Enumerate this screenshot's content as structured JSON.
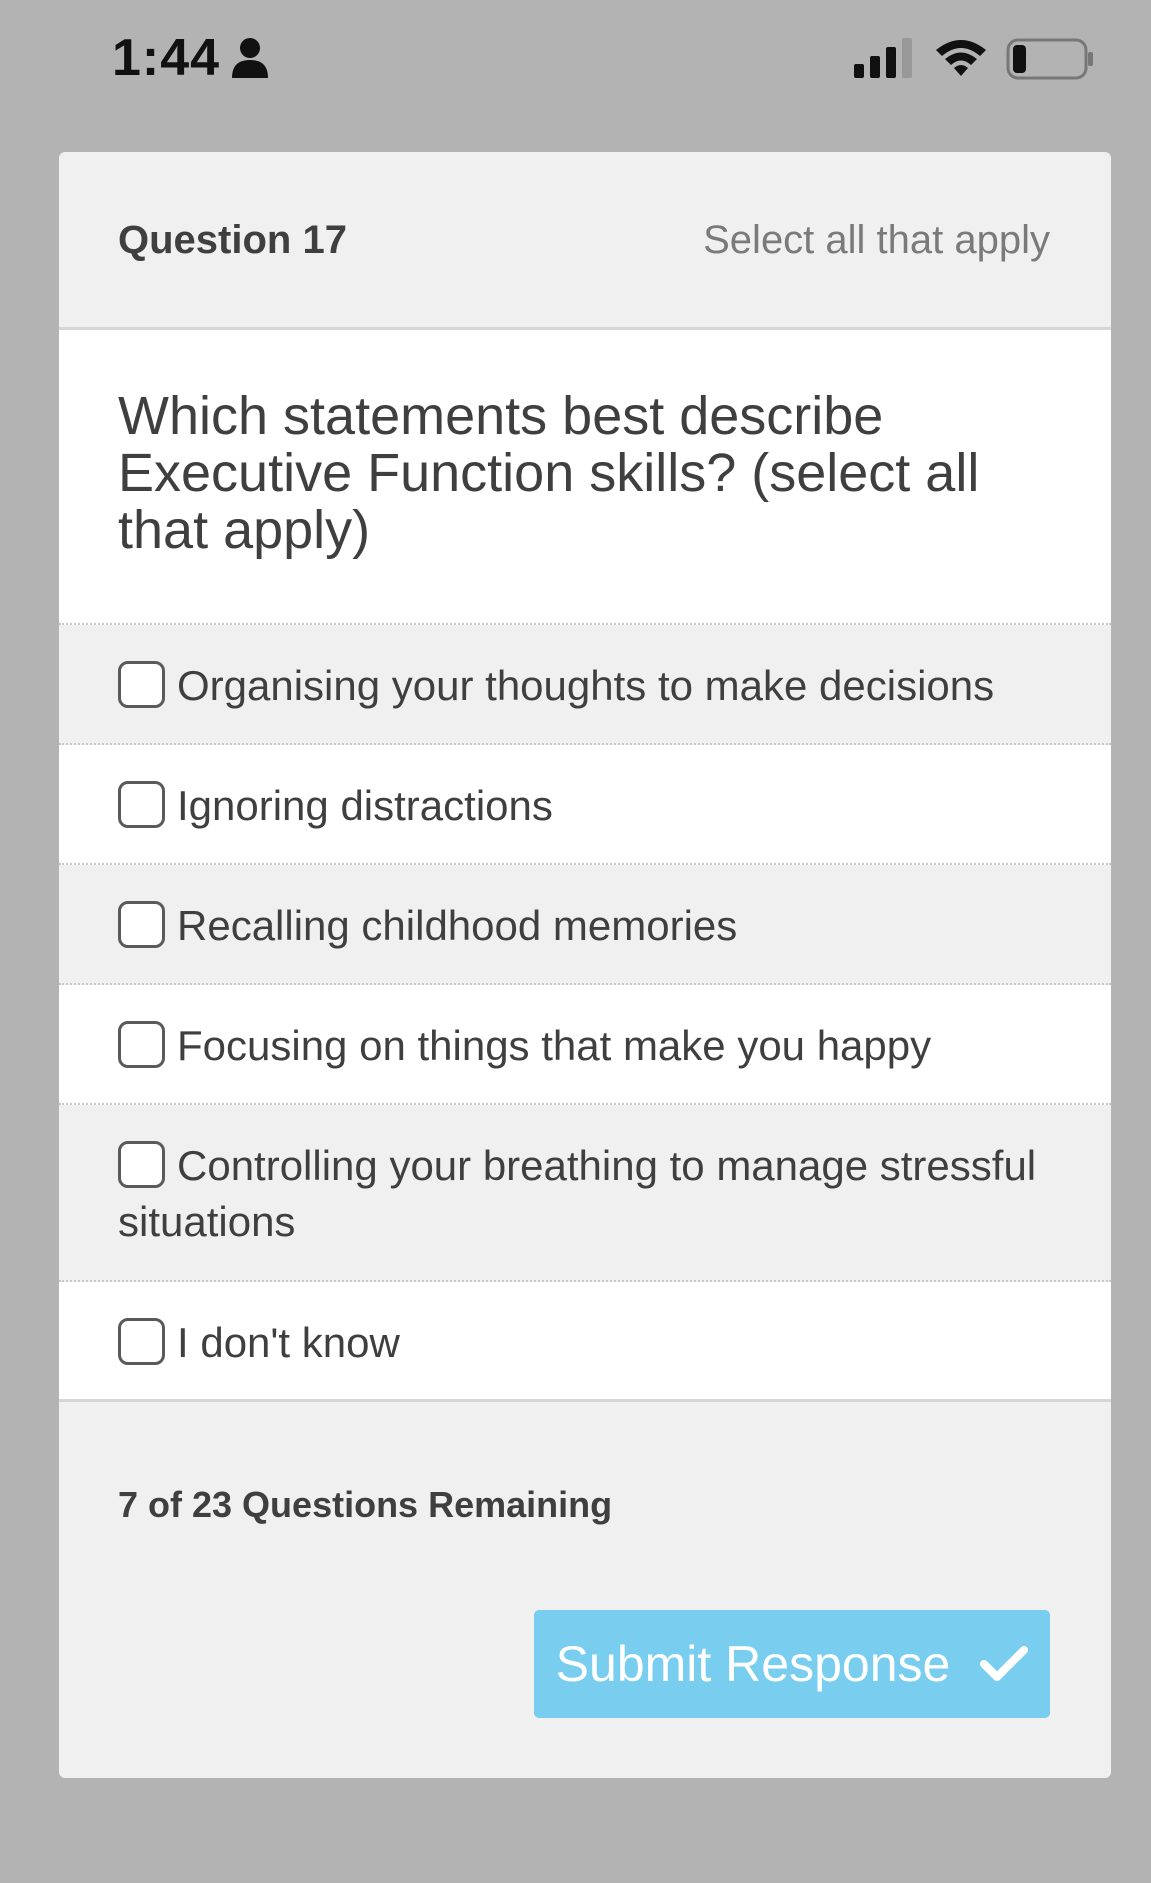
{
  "status_bar": {
    "time": "1:44",
    "icons": [
      "person-icon",
      "cellular-signal-icon",
      "wifi-icon",
      "battery-icon"
    ]
  },
  "header": {
    "question_number": "Question 17",
    "hint": "Select all that apply"
  },
  "question": {
    "text": "Which statements best describe Executive Function skills? (select all that apply)"
  },
  "options": [
    {
      "label": "Organising your thoughts to make decisions",
      "checked": false
    },
    {
      "label": "Ignoring distractions",
      "checked": false
    },
    {
      "label": "Recalling childhood memories",
      "checked": false
    },
    {
      "label": "Focusing on things that make you happy",
      "checked": false
    },
    {
      "label": "Controlling your breathing to manage stressful situations",
      "checked": false
    },
    {
      "label": "I don't know",
      "checked": false
    }
  ],
  "footer": {
    "remaining": "7 of 23 Questions Remaining",
    "submit_label": "Submit Response",
    "submit_icon": "checkmark-icon"
  },
  "colors": {
    "background": "#b3b3b3",
    "card": "#f0f0f0",
    "submit_button": "#79cdee",
    "text": "#3f3f3f"
  }
}
